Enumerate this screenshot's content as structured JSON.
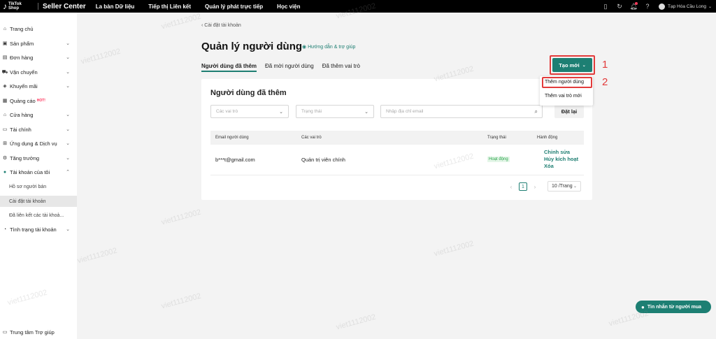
{
  "topbar": {
    "logo_line1": "TikTok",
    "logo_line2": "Shop",
    "brand": "Seller Center",
    "nav": [
      "La bàn Dữ liệu",
      "Tiếp thị Liên kết",
      "Quản lý phát trực tiếp",
      "Học viện"
    ],
    "store_name": "Tạp Hóa Cầu Long"
  },
  "sidebar": {
    "items": [
      {
        "label": "Trang chủ",
        "icon": "home-icon",
        "chevron": false
      },
      {
        "label": "Sản phẩm",
        "icon": "box-icon",
        "chevron": true
      },
      {
        "label": "Đơn hàng",
        "icon": "order-icon",
        "chevron": true
      },
      {
        "label": "Vận chuyển",
        "icon": "truck-icon",
        "chevron": true
      },
      {
        "label": "Khuyến mãi",
        "icon": "promo-icon",
        "chevron": true
      },
      {
        "label": "Quảng cáo",
        "icon": "ads-icon",
        "chevron": false,
        "badge": "HOT!"
      },
      {
        "label": "Cửa hàng",
        "icon": "store-icon",
        "chevron": true
      },
      {
        "label": "Tài chính",
        "icon": "finance-icon",
        "chevron": true
      },
      {
        "label": "Ứng dụng & Dịch vụ",
        "icon": "apps-icon",
        "chevron": true
      },
      {
        "label": "Tăng trưởng",
        "icon": "growth-icon",
        "chevron": true
      },
      {
        "label": "Tài khoản của tôi",
        "icon": "account-icon",
        "chevron": true,
        "expanded": true
      }
    ],
    "subitems": [
      "Hồ sơ người bán",
      "Cài đặt tài khoản",
      "Đã liên kết các tài khoả..."
    ],
    "after_items": [
      {
        "label": "Tình trạng tài khoản",
        "icon": "status-icon",
        "chevron": true
      }
    ],
    "help": "Trung tâm Trợ giúp"
  },
  "breadcrumb": "Cài đặt tài khoản",
  "page_title": "Quản lý người dùng",
  "help_link": "Hướng dẫn & trợ giúp",
  "tabs": [
    "Người dùng đã thêm",
    "Đã mời người dùng",
    "Đã thêm vai trò"
  ],
  "create_button": "Tạo mới",
  "dropdown": [
    "Thêm người dùng",
    "Thêm vai trò mới"
  ],
  "annotations": [
    "1",
    "2"
  ],
  "card": {
    "title": "Người dùng đã thêm",
    "filters": {
      "role_placeholder": "Các vai trò",
      "status_placeholder": "Trạng thái",
      "email_placeholder": "Nhập địa chỉ email",
      "reset": "Đặt lại"
    },
    "columns": [
      "Email người dùng",
      "Các vai trò",
      "Trạng thái",
      "Hành động"
    ],
    "row": {
      "email": "b***t@gmail.com",
      "role": "Quản trị viên chính",
      "status": "Hoạt động",
      "actions": [
        "Chỉnh sửa",
        "Hủy kích hoạt",
        "Xóa"
      ]
    },
    "pagination": {
      "page": "1",
      "page_size": "10 /Trang"
    }
  },
  "chat_button": "Tin nhắn từ người mua",
  "watermark_text": "viet1112002",
  "colors": {
    "accent": "#1d7f73",
    "annotation": "#e23b3b",
    "hot": "#fe2c55"
  }
}
